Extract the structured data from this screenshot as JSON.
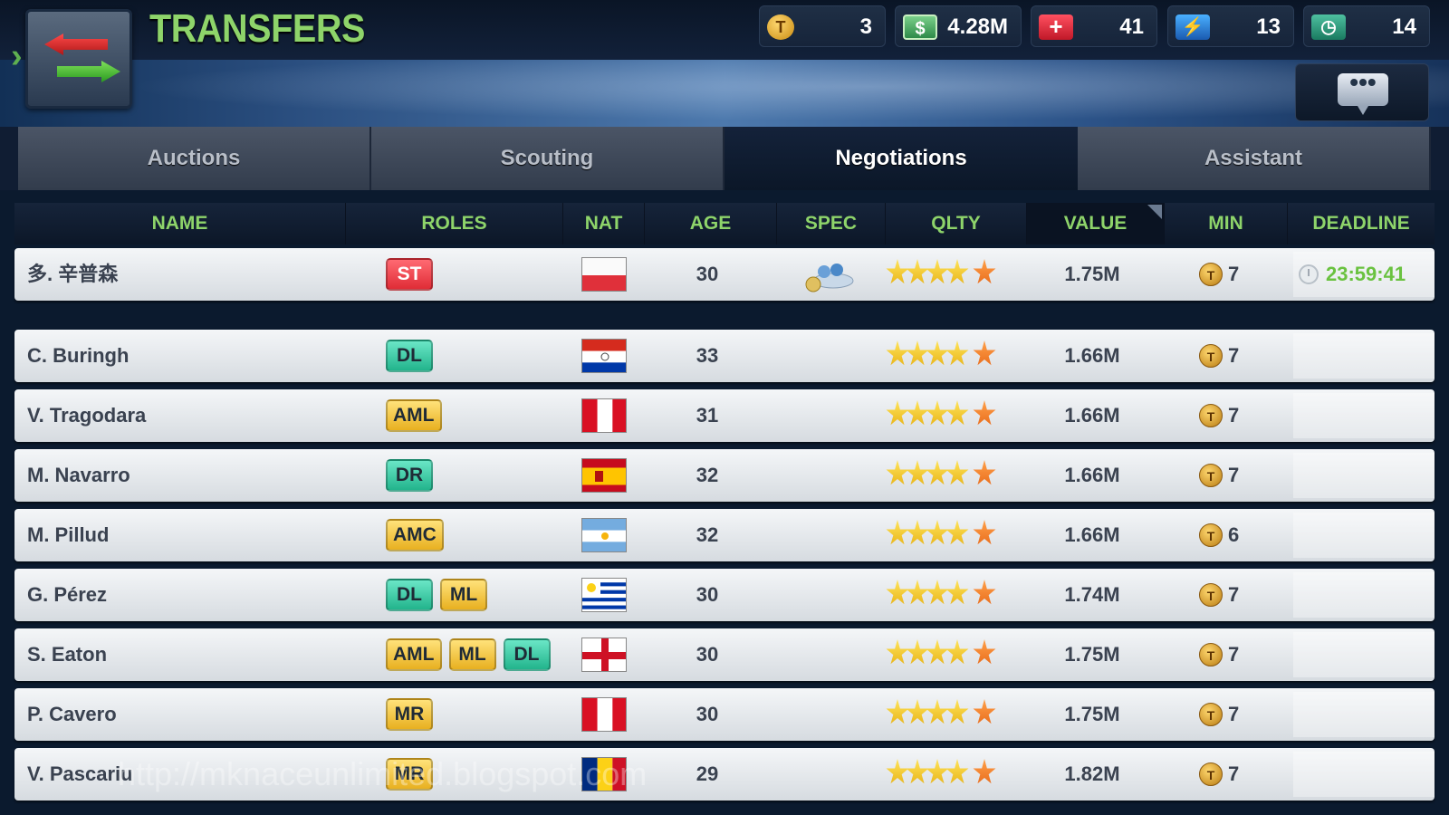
{
  "header": {
    "title": "TRANSFERS",
    "currencies": [
      {
        "icon": "token-icon",
        "glyph": "T",
        "value": "3"
      },
      {
        "icon": "cash-icon",
        "glyph": "$",
        "value": "4.28M"
      },
      {
        "icon": "medical-icon",
        "glyph": "+",
        "value": "41"
      },
      {
        "icon": "energy-icon",
        "glyph": "⚡",
        "value": "13"
      },
      {
        "icon": "training-icon",
        "glyph": "◷",
        "value": "14"
      }
    ],
    "chat_glyph": "•••"
  },
  "tabs": [
    {
      "label": "Auctions",
      "active": false
    },
    {
      "label": "Scouting",
      "active": false
    },
    {
      "label": "Negotiations",
      "active": true
    },
    {
      "label": "Assistant",
      "active": false
    }
  ],
  "table": {
    "columns": [
      "NAME",
      "ROLES",
      "NAT",
      "AGE",
      "SPEC",
      "QLTY",
      "VALUE",
      "MIN",
      "DEADLINE"
    ],
    "sorted_column": "VALUE",
    "coin_glyph": "T",
    "rows": [
      {
        "name": "多. 辛普森",
        "roles": [
          {
            "label": "ST",
            "kind": "att"
          }
        ],
        "nat": "poland",
        "age": "30",
        "spec": true,
        "stars": 4.5,
        "value": "1.75M",
        "min": "7",
        "deadline": "23:59:41"
      },
      {
        "name": "C. Buringh",
        "roles": [
          {
            "label": "DL",
            "kind": "def"
          }
        ],
        "nat": "paraguay",
        "age": "33",
        "spec": false,
        "stars": 4.5,
        "value": "1.66M",
        "min": "7",
        "deadline": ""
      },
      {
        "name": "V. Tragodara",
        "roles": [
          {
            "label": "AML",
            "kind": "mid"
          }
        ],
        "nat": "peru",
        "age": "31",
        "spec": false,
        "stars": 4.5,
        "value": "1.66M",
        "min": "7",
        "deadline": ""
      },
      {
        "name": "M. Navarro",
        "roles": [
          {
            "label": "DR",
            "kind": "def"
          }
        ],
        "nat": "spain",
        "age": "32",
        "spec": false,
        "stars": 4.5,
        "value": "1.66M",
        "min": "7",
        "deadline": ""
      },
      {
        "name": "M. Pillud",
        "roles": [
          {
            "label": "AMC",
            "kind": "mid"
          }
        ],
        "nat": "argentina",
        "age": "32",
        "spec": false,
        "stars": 4.5,
        "value": "1.66M",
        "min": "6",
        "deadline": ""
      },
      {
        "name": "G. Pérez",
        "roles": [
          {
            "label": "DL",
            "kind": "def"
          },
          {
            "label": "ML",
            "kind": "mid"
          }
        ],
        "nat": "uruguay",
        "age": "30",
        "spec": false,
        "stars": 4.5,
        "value": "1.74M",
        "min": "7",
        "deadline": ""
      },
      {
        "name": "S. Eaton",
        "roles": [
          {
            "label": "AML",
            "kind": "mid"
          },
          {
            "label": "ML",
            "kind": "mid"
          },
          {
            "label": "DL",
            "kind": "def"
          }
        ],
        "nat": "england",
        "age": "30",
        "spec": false,
        "stars": 4.5,
        "value": "1.75M",
        "min": "7",
        "deadline": ""
      },
      {
        "name": "P. Cavero",
        "roles": [
          {
            "label": "MR",
            "kind": "mid"
          }
        ],
        "nat": "peru",
        "age": "30",
        "spec": false,
        "stars": 4.5,
        "value": "1.75M",
        "min": "7",
        "deadline": ""
      },
      {
        "name": "V. Pascariu",
        "roles": [
          {
            "label": "MR",
            "kind": "mid"
          }
        ],
        "nat": "romania",
        "age": "29",
        "spec": false,
        "stars": 4.5,
        "value": "1.82M",
        "min": "7",
        "deadline": ""
      }
    ]
  },
  "watermark": "http://mknaceunlimited.blogspot.com",
  "colors": {
    "accent_green": "#8ed46a",
    "deadline_green": "#6ac240"
  }
}
